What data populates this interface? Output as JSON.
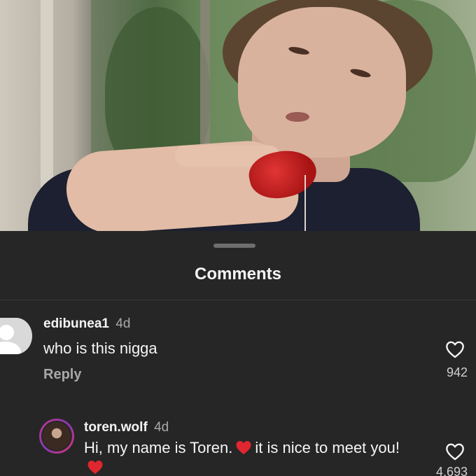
{
  "sheet": {
    "title": "Comments"
  },
  "comments": [
    {
      "username": "edibunea1",
      "time": "4d",
      "text": "who is this nigga",
      "reply_label": "Reply",
      "likes": "942"
    },
    {
      "username": "toren.wolf",
      "time": "4d",
      "text_part1": "Hi, my name is Toren.",
      "text_part2": "it is nice to meet you!",
      "likes": "4,693"
    }
  ],
  "icons": {
    "like": "heart-outline-icon",
    "emoji": "red-heart-emoji",
    "avatar_default": "default-avatar-icon"
  },
  "colors": {
    "background": "#262626",
    "text": "#f5f5f5",
    "muted": "#a8a8a8",
    "emoji_heart": "#e0262f"
  }
}
